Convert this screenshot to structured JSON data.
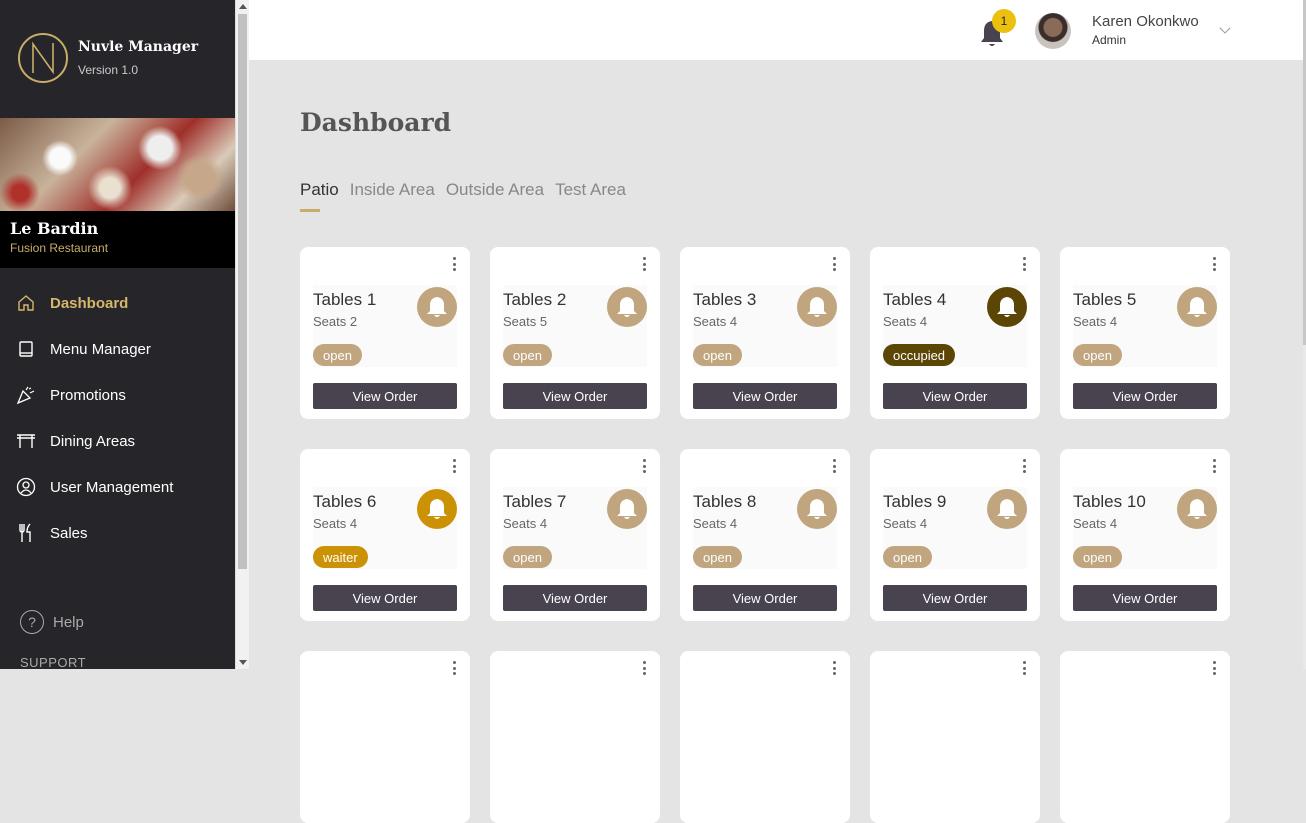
{
  "brand": {
    "name": "Nuvle Manager",
    "version": "Version 1.0",
    "logo_letter": "N"
  },
  "restaurant": {
    "name": "Le Bardin",
    "subtitle": "Fusion Restaurant"
  },
  "nav": [
    {
      "label": "Dashboard",
      "icon": "home-icon",
      "active": true
    },
    {
      "label": "Menu Manager",
      "icon": "book-icon",
      "active": false
    },
    {
      "label": "Promotions",
      "icon": "party-popper-icon",
      "active": false
    },
    {
      "label": "Dining Areas",
      "icon": "table-icon",
      "active": false
    },
    {
      "label": "User Management",
      "icon": "user-circle-icon",
      "active": false
    },
    {
      "label": "Sales",
      "icon": "utensils-icon",
      "active": false
    }
  ],
  "help": {
    "label": "Help",
    "support": "SUPPORT"
  },
  "header": {
    "notif_count": "1",
    "user_name": "Karen Okonkwo",
    "user_role": "Admin"
  },
  "page": {
    "title": "Dashboard"
  },
  "tabs": [
    {
      "label": "Patio",
      "active": true
    },
    {
      "label": "Inside Area",
      "active": false
    },
    {
      "label": "Outside Area",
      "active": false
    },
    {
      "label": "Test Area",
      "active": false
    }
  ],
  "status_colors": {
    "open": "#c0a57f",
    "occupied": "#5c4605",
    "waiter": "#cc9205"
  },
  "view_order_label": "View Order",
  "tables": [
    {
      "name": "Tables 1",
      "seats": "Seats 2",
      "status": "open"
    },
    {
      "name": "Tables 2",
      "seats": "Seats 5",
      "status": "open"
    },
    {
      "name": "Tables 3",
      "seats": "Seats 4",
      "status": "open"
    },
    {
      "name": "Tables 4",
      "seats": "Seats 4",
      "status": "occupied"
    },
    {
      "name": "Tables 5",
      "seats": "Seats 4",
      "status": "open"
    },
    {
      "name": "Tables 6",
      "seats": "Seats 4",
      "status": "waiter"
    },
    {
      "name": "Tables 7",
      "seats": "Seats 4",
      "status": "open"
    },
    {
      "name": "Tables 8",
      "seats": "Seats 4",
      "status": "open"
    },
    {
      "name": "Tables 9",
      "seats": "Seats 4",
      "status": "open"
    },
    {
      "name": "Tables 10",
      "seats": "Seats 4",
      "status": "open"
    }
  ]
}
